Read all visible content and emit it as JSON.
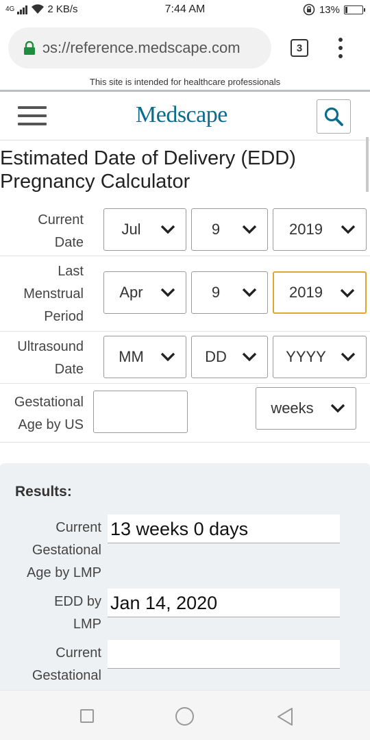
{
  "status_bar": {
    "network": "4G",
    "speed": "2 KB/s",
    "time": "7:44 AM",
    "battery": "13%",
    "battery_level": 0.13
  },
  "browser": {
    "url": "ɔs://reference.medscape.com",
    "tab_count": "3"
  },
  "site": {
    "notice": "This site is intended for healthcare professionals",
    "logo_text": "Medscape",
    "logo_color": "#0a6d8e"
  },
  "page": {
    "title": "Estimated Date of Delivery (EDD) Pregnancy Calculator"
  },
  "form": {
    "current_date": {
      "label_line1": "Current",
      "label_line2": "Date",
      "month": "Jul",
      "day": "9",
      "year": "2019"
    },
    "lmp": {
      "label_line1": "Last",
      "label_line2": "Menstrual",
      "label_line3": "Period",
      "month": "Apr",
      "day": "9",
      "year": "2019"
    },
    "ultrasound": {
      "label_line1": "Ultrasound",
      "label_line2": "Date",
      "month": "MM",
      "day": "DD",
      "year": "YYYY"
    },
    "gestational_us": {
      "label_line1": "Gestational",
      "label_line2": "Age by US",
      "value": "",
      "unit": "weeks"
    }
  },
  "results": {
    "heading": "Results:",
    "current_ga_lmp": {
      "label_line1": "Current",
      "label_line2": "Gestational",
      "label_line3": "Age by LMP",
      "value": "13 weeks 0 days"
    },
    "edd_lmp": {
      "label_line1": "EDD by",
      "label_line2": "LMP",
      "value": "Jan 14, 2020"
    },
    "current_ga_us": {
      "label_line1": "Current",
      "label_line2": "Gestational",
      "value": ""
    }
  },
  "colors": {
    "focus_border": "#e0a62c",
    "results_bg": "#eef1f3",
    "lock_green": "#1e8e3e"
  }
}
